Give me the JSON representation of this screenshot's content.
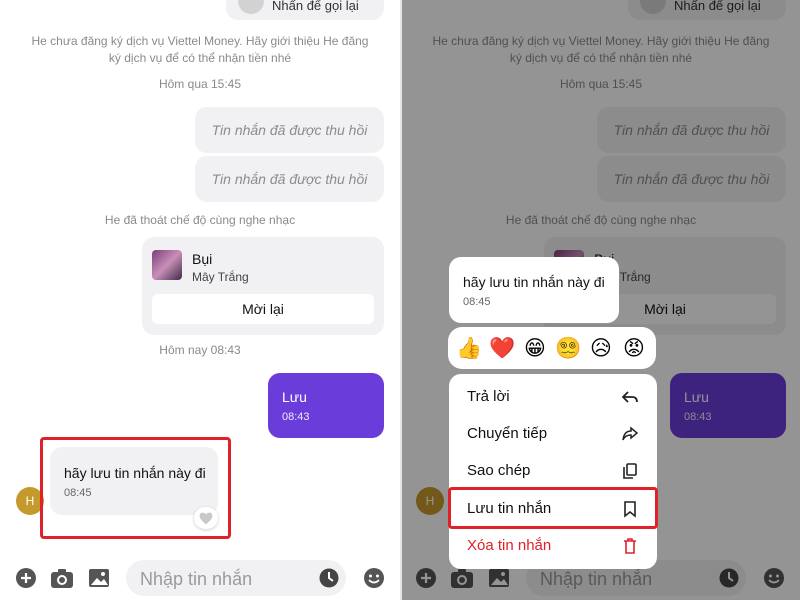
{
  "left": {
    "top_partial_call": "Nhấn để gọi lại",
    "system_notice": "He chưa đăng ký dịch vụ Viettel Money. Hãy giới thiệu He đăng ký dịch vụ để có thể nhận tiền nhé",
    "time_yesterday": "Hôm qua 15:45",
    "recalled_1": "Tin nhắn đã được thu hồi",
    "recalled_2": "Tin nhắn đã được thu hồi",
    "music_notice": "He đã thoát chế độ cùng nghe nhạc",
    "music_card": {
      "title": "Bụi",
      "artist": "Mây Trắng",
      "reinvite": "Mời lại"
    },
    "time_today": "Hôm nay 08:43",
    "my_message": {
      "text": "Lưu",
      "time": "08:43"
    },
    "incoming_message": {
      "text": "hãy lưu tin nhắn này đi",
      "time": "08:45"
    },
    "avatar_letter": "H",
    "input_placeholder": "Nhập tin nhắn"
  },
  "right": {
    "top_partial_call": "Nhấn để gọi lại",
    "system_notice": "He chưa đăng ký dịch vụ Viettel Money. Hãy giới thiệu He đăng ký dịch vụ để có thể nhận tiền nhé",
    "time_yesterday": "Hôm qua 15:45",
    "recalled_1": "Tin nhắn đã được thu hồi",
    "recalled_2": "Tin nhắn đã được thu hồi",
    "music_notice": "He đã thoát chế độ cùng nghe nhạc",
    "music_title_partial": "Bụi",
    "music_artist_partial": "Mây Trắng",
    "music_reinvite": "Mời lại",
    "my_message": {
      "text": "Lưu",
      "time": "08:43"
    },
    "avatar_letter": "H",
    "input_placeholder": "Nhập tin nhắn",
    "preview": {
      "text": "hãy lưu tin nhắn này đi",
      "time": "08:45"
    },
    "reactions": [
      "👍",
      "❤️",
      "😁",
      "😵‍💫",
      "😥",
      "😡"
    ],
    "menu": [
      {
        "label": "Trả lời",
        "icon": "reply-icon"
      },
      {
        "label": "Chuyển tiếp",
        "icon": "forward-icon"
      },
      {
        "label": "Sao chép",
        "icon": "copy-icon"
      },
      {
        "label": "Lưu tin nhắn",
        "icon": "bookmark-icon"
      },
      {
        "label": "Xóa tin nhắn",
        "icon": "trash-icon"
      }
    ]
  },
  "colors": {
    "accent_purple": "#6a3cd9",
    "highlight_red": "#e2202a",
    "bubble_gray": "#f1f1f3",
    "avatar_gold": "#c49a2c"
  }
}
